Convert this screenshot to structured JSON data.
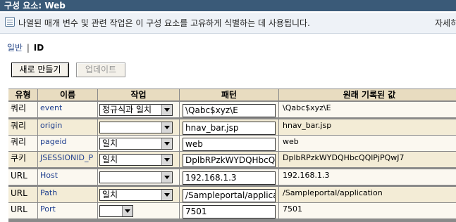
{
  "window": {
    "title": "구성 요소: Web"
  },
  "info": {
    "text": "나열된 매개 변수 및 관련 작업은 이 구성 요소를 고유하게 식별하는 데 사용됩니다.",
    "more_link": "자세히"
  },
  "tabs": {
    "general": "일반",
    "separator": "|",
    "current": "ID"
  },
  "buttons": {
    "new": "새로 만들기",
    "update": "업데이트"
  },
  "table": {
    "headers": [
      "유형",
      "이름",
      "작업",
      "패턴",
      "원래 기록된 값"
    ],
    "rows": [
      {
        "type": "쿼리",
        "name": "event",
        "action": "정규식과 일치",
        "pattern": "\\Qabc$xyz\\E",
        "original": "\\Qabc$xyz\\E"
      },
      {
        "type": "쿼리",
        "name": "origin",
        "action": "",
        "pattern": "hnav_bar.jsp",
        "original": "hnav_bar.jsp"
      },
      {
        "type": "쿼리",
        "name": "pageid",
        "action": "일치",
        "pattern": "web",
        "original": "web"
      },
      {
        "type": "쿠키",
        "name": "JSESSIONID_P",
        "action": "일치",
        "pattern": "DplbRPzkWYDQHbcQC",
        "original": "DplbRPzkWYDQHbcQQlPjPQwJ7"
      },
      {
        "type": "URL",
        "name": "Host",
        "action": "",
        "pattern": "192.168.1.3",
        "original": "192.168.1.3"
      },
      {
        "type": "URL",
        "name": "Path",
        "action": "일치",
        "pattern": "/Sampleportal/applicatio",
        "original": "/Sampleportal/application"
      },
      {
        "type": "URL",
        "name": "Port",
        "action": "",
        "pattern": "7501",
        "original": "7501"
      }
    ]
  },
  "colors": {
    "title_bar": "#3a5a78",
    "header_row": "#e8dcc0",
    "row_light": "#fbf8f0",
    "row_dark": "#f3ecd6"
  }
}
